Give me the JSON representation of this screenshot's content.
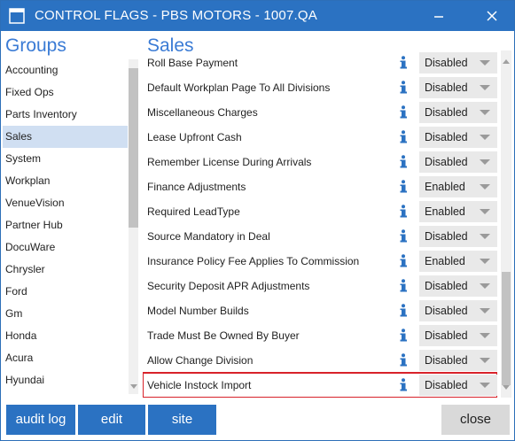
{
  "window": {
    "title": "CONTROL FLAGS - PBS MOTORS - 1007.QA",
    "accent_color": "#2b72c2",
    "app_icon": "window-app-icon",
    "minimize_icon": "minimize-icon",
    "close_icon": "close-icon"
  },
  "groups": {
    "heading": "Groups",
    "selected": "Sales",
    "items": [
      "Accounting",
      "Fixed Ops",
      "Parts Inventory",
      "Sales",
      "System",
      "Workplan",
      "VenueVision",
      "Partner Hub",
      "DocuWare",
      "Chrysler",
      "Ford",
      "Gm",
      "Honda",
      "Acura",
      "Hyundai"
    ]
  },
  "settings": {
    "heading": "Sales",
    "info_icon": "info-icon",
    "highlight_color": "#d8222a",
    "rows": [
      {
        "label": "Roll Base Payment",
        "value": "Disabled"
      },
      {
        "label": "Default Workplan Page To All Divisions",
        "value": "Disabled"
      },
      {
        "label": "Miscellaneous Charges",
        "value": "Disabled"
      },
      {
        "label": "Lease Upfront Cash",
        "value": "Disabled"
      },
      {
        "label": "Remember License During Arrivals",
        "value": "Disabled"
      },
      {
        "label": "Finance Adjustments",
        "value": "Enabled"
      },
      {
        "label": "Required LeadType",
        "value": "Enabled"
      },
      {
        "label": "Source Mandatory in Deal",
        "value": "Disabled"
      },
      {
        "label": "Insurance Policy Fee Applies To Commission",
        "value": "Enabled"
      },
      {
        "label": "Security Deposit APR Adjustments",
        "value": "Disabled"
      },
      {
        "label": "Model Number Builds",
        "value": "Disabled"
      },
      {
        "label": "Trade Must Be Owned By Buyer",
        "value": "Disabled"
      },
      {
        "label": "Allow Change Division",
        "value": "Disabled"
      },
      {
        "label": "Vehicle Instock Import",
        "value": "Disabled",
        "highlighted": true
      }
    ]
  },
  "footer": {
    "audit_log": "audit log",
    "edit": "edit",
    "site": "site",
    "close": "close"
  }
}
